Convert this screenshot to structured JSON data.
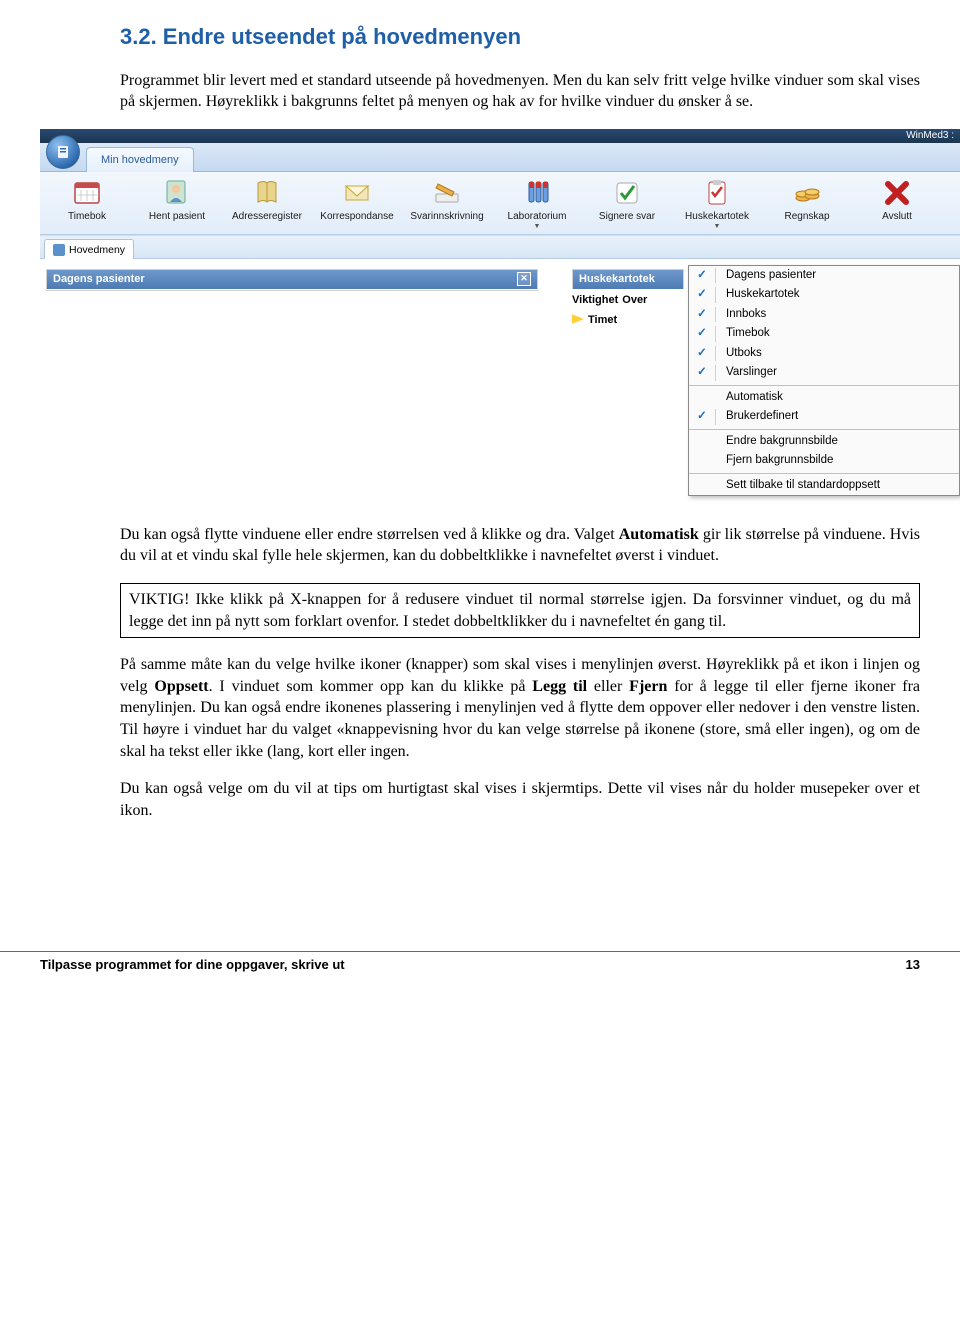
{
  "doc": {
    "heading": "3.2.  Endre utseendet på hovedmenyen",
    "p1": "Programmet blir levert med et standard utseende på hovedmenyen. Men du kan selv fritt velge hvilke vinduer som skal vises på skjermen. Høyreklikk i bakgrunns feltet på menyen og hak av for hvilke vinduer du ønsker å se.",
    "p2a": "Du kan også flytte vinduene eller endre størrelsen ved å klikke og dra. Valget ",
    "p2b": "Automatisk",
    "p2c": " gir lik størrelse på vinduene. Hvis du vil at et vindu skal fylle hele skjermen, kan du dobbeltklikke i navnefeltet øverst i vinduet.",
    "callout": "VIKTIG! Ikke klikk på X-knappen for å redusere vinduet til normal størrelse igjen. Da forsvinner vinduet, og du må legge det inn på nytt som forklart ovenfor. I stedet dobbeltklikker du i navnefeltet én gang til.",
    "p3a": "På samme måte kan du velge hvilke ikoner (knapper) som skal vises i menylinjen øverst. Høyreklikk på et ikon i linjen og velg ",
    "p3b": "Oppsett",
    "p3c": ". I vinduet som kommer opp kan du klikke på ",
    "p3d": "Legg til",
    "p3e": " eller ",
    "p3f": "Fjern",
    "p3g": " for å legge til eller fjerne ikoner fra menylinjen. Du kan også endre ikonenes plassering i menylinjen ved å flytte dem oppover eller nedover i den venstre listen. Til høyre i vinduet har du valget «knappevisning hvor du kan velge størrelse på ikonene (store, små eller ingen), og om de skal ha tekst eller ikke (lang, kort eller ingen.",
    "p4": "Du kan også velge om du vil at tips om hurtigtast skal vises i skjermtips. Dette vil vises når du holder musepeker over et ikon.",
    "footer_left": "Tilpasse programmet for dine oppgaver, skrive ut",
    "footer_page": "13"
  },
  "shot": {
    "app_title": "WinMed3 :",
    "maintab": "Min hovedmeny",
    "toolbar": [
      {
        "label": "Timebok",
        "icon": "calendar"
      },
      {
        "label": "Hent pasient",
        "icon": "person"
      },
      {
        "label": "Adresseregister",
        "icon": "book"
      },
      {
        "label": "Korrespondanse",
        "icon": "envelope"
      },
      {
        "label": "Svarinnskrivning",
        "icon": "pencil"
      },
      {
        "label": "Laboratorium",
        "icon": "tubes",
        "dropdown": true
      },
      {
        "label": "Signere svar",
        "icon": "check"
      },
      {
        "label": "Huskekartotek",
        "icon": "clipboard",
        "dropdown": true
      },
      {
        "label": "Regnskap",
        "icon": "coins"
      },
      {
        "label": "Avslutt",
        "icon": "close-red"
      }
    ],
    "ws_tab": "Hovedmeny",
    "panel_left": "Dagens pasienter",
    "panel_mid": "Huskekartotek",
    "mid_l1a": "Viktighet",
    "mid_l1b": "Over",
    "mid_l2": "Timet",
    "ctx": {
      "checked": [
        {
          "label": "Dagens pasienter",
          "check": true
        },
        {
          "label": "Huskekartotek",
          "check": true
        },
        {
          "label": "Innboks",
          "check": true
        },
        {
          "label": "Timebok",
          "check": true
        },
        {
          "label": "Utboks",
          "check": true
        },
        {
          "label": "Varslinger",
          "check": true
        }
      ],
      "mode": [
        {
          "label": "Automatisk",
          "check": false
        },
        {
          "label": "Brukerdefinert",
          "check": true
        }
      ],
      "bg": [
        {
          "label": "Endre bakgrunnsbilde"
        },
        {
          "label": "Fjern bakgrunnsbilde"
        }
      ],
      "reset": {
        "label": "Sett tilbake til standardoppsett"
      }
    }
  }
}
